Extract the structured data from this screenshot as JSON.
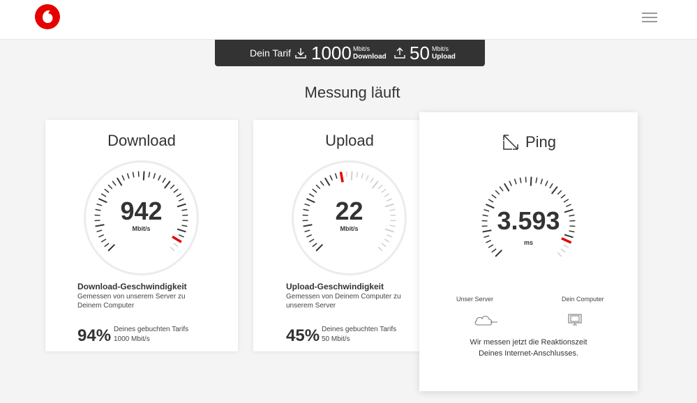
{
  "header": {
    "logo": "vodafone-logo",
    "menu_icon": "hamburger-icon"
  },
  "tarif": {
    "label": "Dein Tarif",
    "download_value": "1000",
    "download_unit": "Mbit/s",
    "download_label": "Download",
    "upload_value": "50",
    "upload_unit": "Mbit/s",
    "upload_label": "Upload"
  },
  "headline": "Messung läuft",
  "download": {
    "title": "Download",
    "value": "942",
    "unit": "Mbit/s",
    "fraction": 0.94,
    "desc_title": "Download-Geschwindigkeit",
    "desc_line1": "Gemessen von unserem Server zu",
    "desc_line2": "Deinem Computer",
    "percent": "94%",
    "percent_text1": "Deines gebuchten Tarifs",
    "percent_text2": "1000 Mbit/s"
  },
  "upload": {
    "title": "Upload",
    "value": "22",
    "unit": "Mbit/s",
    "fraction": 0.45,
    "desc_title": "Upload-Geschwindigkeit",
    "desc_line1": "Gemessen von Deinem Computer zu",
    "desc_line2": "unserem Server",
    "percent": "45%",
    "percent_text1": "Deines gebuchten Tarifs",
    "percent_text2": "50 Mbit/s"
  },
  "ping": {
    "title": "Ping",
    "value": "3.593",
    "unit": "ms",
    "fraction": 0.93,
    "server_label": "Unser Server",
    "computer_label": "Dein Computer",
    "note_line1": "Wir messen jetzt die Reaktionszeit",
    "note_line2": "Deines Internet-Anschlusses."
  },
  "colors": {
    "accent": "#e60000",
    "dark": "#333333"
  }
}
